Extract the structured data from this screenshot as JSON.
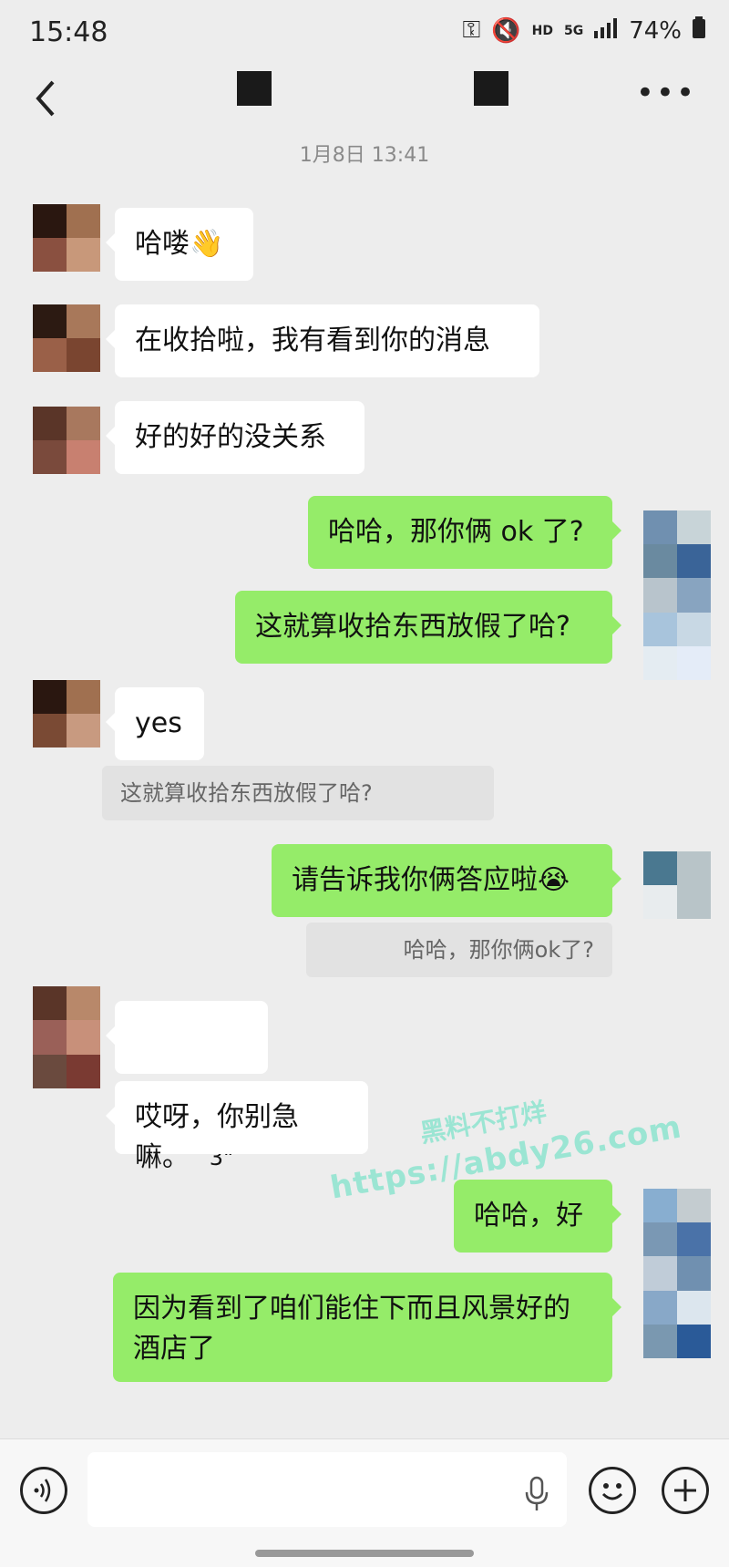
{
  "status_bar": {
    "time": "15:48",
    "battery": "74%",
    "hd_label": "HD",
    "network_label": "5G"
  },
  "chat": {
    "date_separator": "1月8日 13:41"
  },
  "messages": [
    {
      "side": "in",
      "text": "哈喽👋"
    },
    {
      "side": "in",
      "text": "在收拾啦，我有看到你的消息"
    },
    {
      "side": "in",
      "text": "好的好的没关系"
    },
    {
      "side": "out",
      "text": "哈哈，那你俩 ok 了?"
    },
    {
      "side": "out",
      "text": "这就算收拾东西放假了哈?"
    },
    {
      "side": "in",
      "text": "yes"
    },
    {
      "side": "quote",
      "text": "这就算收拾东西放假了哈?"
    },
    {
      "side": "out",
      "text": "请告诉我你俩答应啦😭"
    },
    {
      "side": "quote",
      "text": "哈哈，那你俩ok了?"
    },
    {
      "side": "in",
      "text": "3\""
    },
    {
      "side": "in",
      "text": "哎呀，你别急嘛。"
    },
    {
      "side": "out",
      "text": "哈哈，好"
    },
    {
      "side": "out",
      "text": "因为看到了咱们能住下而且风景好的酒店了"
    }
  ],
  "watermark": {
    "line1": "黑料不打烊",
    "line2": "https://abdy26.com"
  },
  "icons": [
    "back-icon",
    "more-icon",
    "voice-toggle-icon",
    "microphone-icon",
    "emoji-icon",
    "plus-icon"
  ]
}
